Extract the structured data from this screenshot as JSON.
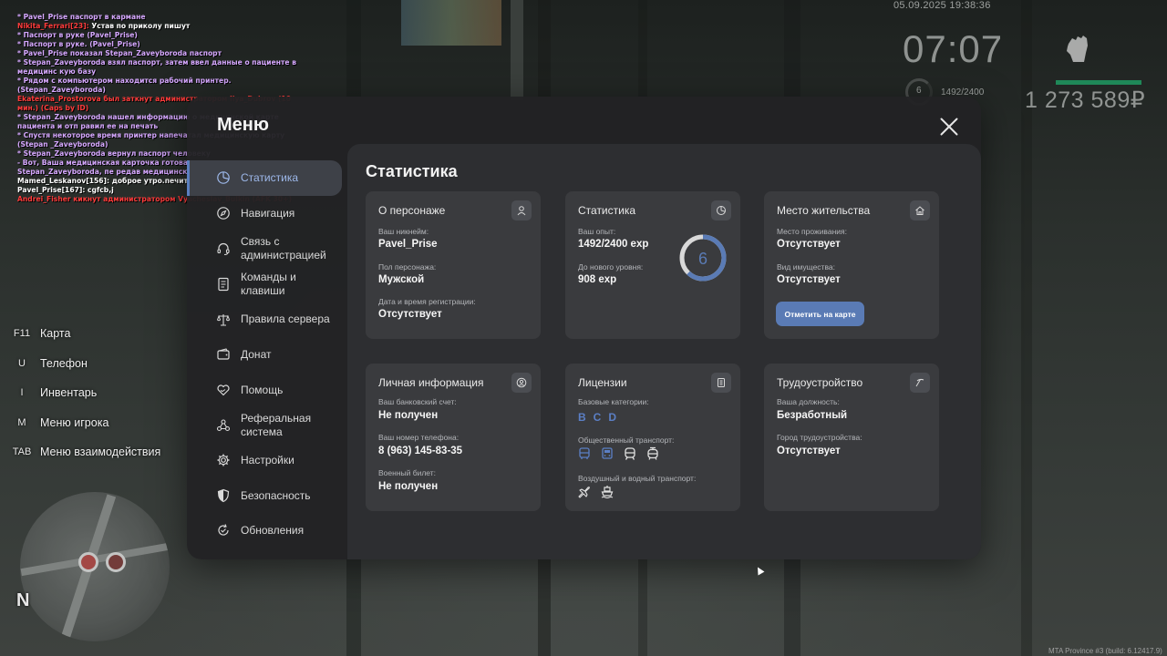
{
  "chat": [
    {
      "color": "violet",
      "text": "* Pavel_Prise паспорт в кармане"
    },
    {
      "color": "mixed",
      "parts": [
        {
          "color": "red",
          "text": "Nikita_Ferrari[23]: "
        },
        {
          "color": "white",
          "text": "Устав по приколу пишут"
        }
      ]
    },
    {
      "color": "violet",
      "text": "* Паспорт в руке (Pavel_Prise)"
    },
    {
      "color": "violet",
      "text": "* Паспорт в руке. (Pavel_Prise)"
    },
    {
      "color": "violet",
      "text": "* Pavel_Prise показал Stepan_Zaveyboroda паспорт"
    },
    {
      "color": "violet",
      "text": "* Stepan_Zaveyboroda взял паспорт, затем ввел данные о пациенте в медицинс кую базу"
    },
    {
      "color": "violet",
      "text": "* Рядом с компьютером находится рабочий принтер. (Stepan_Zaveyboroda)"
    },
    {
      "color": "red",
      "text": "Ekaterina_Prostorova был заткнут администратором Ilya_Dubrov (10 мин.) (Caps by ID)"
    },
    {
      "color": "violet",
      "text": "* Stepan_Zaveyboroda нашел информацию о медицинской карте пациента и отп равил ее на печать"
    },
    {
      "color": "violet",
      "text": "* Спустя некоторое время принтер напечатал медицинскую карту (Stepan _Zaveyboroda)"
    },
    {
      "color": "violet",
      "text": "* Stepan_Zaveyboroda вернул паспорт человеку"
    },
    {
      "color": "violet",
      "text": "- Вот, Ваша медицинская карточка готова, - сказал Stepan_Zaveyboroda, пе редав медицинскую карту пациенту напротив."
    },
    {
      "color": "white",
      "text": "Mamed_Leskanov[156]: доброе утро.печите?"
    },
    {
      "color": "white",
      "text": "Pavel_Prise[167]: cgfcb,j"
    },
    {
      "color": "red",
      "text": "Andrei_Fisher кикнут администратором Vyacheslav_Bulkin (AFK 30+)"
    }
  ],
  "hud": {
    "datetime": "05.09.2025 19:38:36",
    "clock": "07:07",
    "level": "6",
    "exp": "1492/2400",
    "money": "1 273 589₽",
    "health_fraction": 1.0,
    "health_color": "#1f9a62"
  },
  "hotkeys": [
    {
      "key": "F11",
      "label": "Карта"
    },
    {
      "key": "U",
      "label": "Телефон"
    },
    {
      "key": "I",
      "label": "Инвентарь"
    },
    {
      "key": "M",
      "label": "Меню игрока"
    },
    {
      "key": "TAB",
      "label": "Меню взаимодействия"
    }
  ],
  "minimap": {
    "north_label": "N"
  },
  "menu": {
    "title": "Меню",
    "accent_color": "#5a7bb5",
    "sidebar": [
      {
        "label": "Статистика",
        "icon": "pie-chart-icon",
        "active": true
      },
      {
        "label": "Навигация",
        "icon": "compass-icon",
        "active": false
      },
      {
        "label": "Связь с администрацией",
        "icon": "headset-icon",
        "active": false
      },
      {
        "label": "Команды и клавиши",
        "icon": "document-icon",
        "active": false
      },
      {
        "label": "Правила сервера",
        "icon": "scales-icon",
        "active": false
      },
      {
        "label": "Донат",
        "icon": "wallet-icon",
        "active": false
      },
      {
        "label": "Помощь",
        "icon": "heart-hands-icon",
        "active": false
      },
      {
        "label": "Реферальная система",
        "icon": "referral-icon",
        "active": false
      },
      {
        "label": "Настройки",
        "icon": "gear-icon",
        "active": false
      },
      {
        "label": "Безопасность",
        "icon": "shield-icon",
        "active": false
      },
      {
        "label": "Обновления",
        "icon": "refresh-icon",
        "active": false
      }
    ],
    "content_title": "Статистика",
    "cards": {
      "character": {
        "title": "О персонаже",
        "nickname_label": "Ваш никнейм:",
        "nickname": "Pavel_Prise",
        "gender_label": "Пол персонажа:",
        "gender": "Мужской",
        "reg_label": "Дата и время регистрации:",
        "reg": "Отсутствует"
      },
      "stats": {
        "title": "Статистика",
        "exp_label": "Ваш опыт:",
        "exp": "1492/2400 exp",
        "next_label": "До нового уровня:",
        "next": "908 exp",
        "level": "6",
        "level_progress": 0.6217
      },
      "residence": {
        "title": "Место жительства",
        "place_label": "Место проживания:",
        "place": "Отсутствует",
        "property_label": "Вид имущества:",
        "property": "Отсутствует",
        "button": "Отметить на карте"
      },
      "personal": {
        "title": "Личная информация",
        "bank_label": "Ваш банковский счет:",
        "bank": "Не получен",
        "phone_label": "Ваш номер телефона:",
        "phone": "8 (963) 145-83-35",
        "military_label": "Военный билет:",
        "military": "Не получен"
      },
      "licenses": {
        "title": "Лицензии",
        "basic_label": "Базовые категории:",
        "basic": [
          "B",
          "C",
          "D"
        ],
        "public_label": "Общественный транспорт:",
        "public_icons": [
          "bus-icon",
          "bus-front-icon",
          "train-icon",
          "tram-icon"
        ],
        "air_label": "Воздушный и водный транспорт:",
        "air_icons": [
          "plane-icon",
          "ship-icon"
        ]
      },
      "employment": {
        "title": "Трудоустройство",
        "position_label": "Ваша должность:",
        "position": "Безработный",
        "city_label": "Город трудоустройства:",
        "city": "Отсутствует"
      }
    }
  },
  "build_info": "MTA Province #3 (build: 6.12417.9)"
}
